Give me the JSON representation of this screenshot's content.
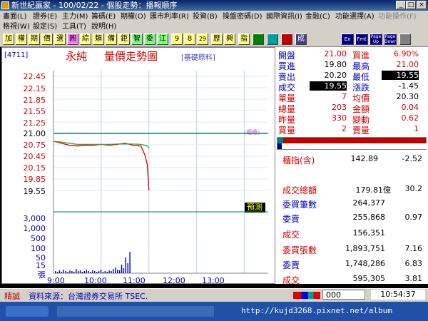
{
  "window": {
    "title": "新世紀贏家 - 100/02/22 - 個股走勢：播報順序"
  },
  "menu": {
    "row1": [
      "畫面(L)",
      "證券(E)",
      "主力(M)",
      "籌碼(E)",
      "期權(O)",
      "匯市利率(R)",
      "投資(B)",
      "操盤密碼(D)",
      "國際資訊(I)",
      "金融(C)",
      "功能選擇(A)",
      "功能操作(F)"
    ],
    "row2": [
      "格視(W)",
      "設定(S)",
      "工具(T)",
      "說明(H)"
    ]
  },
  "toolbar": {
    "buttons": [
      "加",
      "權",
      "期",
      "價",
      "選",
      "圓",
      "綜",
      "類",
      "備",
      "鉅",
      "智",
      "委",
      "江",
      "9",
      "8",
      "29",
      "歷",
      "興",
      "指",
      "",
      "",
      "",
      "成",
      "Ex",
      "Fmt",
      "Page Up",
      "Page Down",
      ""
    ]
  },
  "colors": {
    "accent": "#d00000",
    "blue": "#0000c0",
    "green": "#008000"
  },
  "chart": {
    "code": "[4711]",
    "name": "永純",
    "title": "量價走勢圖",
    "category": "[基礎原料]",
    "ref_label": "(櫃檯)",
    "session_label": "預測",
    "price_labels": [
      "22.45",
      "22.15",
      "21.85",
      "21.55",
      "21.25",
      "21.00",
      "20.75",
      "20.45",
      "20.15",
      "19.85",
      "19.55"
    ],
    "volume_labels": [
      "3,000",
      "1,000",
      "500",
      "100",
      "50",
      "15",
      "張"
    ],
    "time_labels": [
      "9:00",
      "10:00",
      "11:00",
      "12:00",
      "13:00"
    ]
  },
  "chart_data": {
    "type": "line",
    "title": "量價走勢圖",
    "xlabel": "",
    "ylabel": "",
    "x": [
      "9:00",
      "9:10",
      "9:20",
      "9:30",
      "9:40",
      "9:50",
      "10:00",
      "10:10",
      "10:20",
      "10:30",
      "10:40",
      "10:50",
      "10:55",
      "10:58",
      "11:00"
    ],
    "series": [
      {
        "values": [
          20.8,
          20.75,
          20.7,
          20.68,
          20.7,
          20.7,
          20.72,
          20.7,
          20.72,
          20.75,
          20.7,
          20.68,
          20.45,
          20.2,
          19.55
        ]
      },
      {
        "values": [
          20.8,
          20.78,
          20.75,
          20.72,
          20.72,
          20.72,
          20.72,
          20.72,
          20.73,
          20.73,
          20.73,
          20.72,
          20.7,
          20.68,
          20.63
        ]
      }
    ],
    "ylim": [
      19.55,
      22.45
    ],
    "reference": 21.0,
    "grid": true
  },
  "quote": {
    "rows": [
      {
        "l1": "開盤",
        "v1": "21.00",
        "l2": "振幅",
        "v2": "6.90%"
      },
      {
        "l1": "買進",
        "v1": "19.80",
        "l2": "最高",
        "v2": "21.00"
      },
      {
        "l1": "賣出",
        "v1": "20.20",
        "l2": "最低",
        "v2": "19.55"
      },
      {
        "l1": "成交",
        "v1": "19.55",
        "l2": "漲跌",
        "v2": "-1.45"
      },
      {
        "l1": "單量",
        "v1": "7",
        "l2": "均價",
        "v2": "20.30"
      },
      {
        "l1": "總量",
        "v1": "203",
        "l2": "金額",
        "v2": "0.04"
      },
      {
        "l1": "昨量",
        "v1": "330",
        "l2": "變動",
        "v2": "0.62"
      },
      {
        "l1": "買量",
        "v1": "2",
        "l2": "賣量",
        "v2": "1"
      }
    ]
  },
  "index": {
    "label": "櫃指(含)",
    "value": "142.89",
    "change": "-2.52"
  },
  "stats": [
    {
      "label": "成交總額",
      "value": "179.81億",
      "extra": "30.2"
    },
    {
      "label": "委買筆數",
      "value": "264,377",
      "extra": ""
    },
    {
      "label": "委賣",
      "value": "255,868",
      "extra": "0.97"
    },
    {
      "label": "成交",
      "value": "156,351",
      "extra": ""
    },
    {
      "label": "委買張數",
      "value": "1,893,751",
      "extra": "7.16"
    },
    {
      "label": "委賣",
      "value": "1,748,286",
      "extra": "6.83"
    },
    {
      "label": "成交",
      "value": "595,305",
      "extra": "3.81"
    }
  ],
  "status": {
    "tag": "精誠",
    "source": "資料來源：台灣證券交易所 TSEC.",
    "input_value": "000",
    "time": "10:54:37"
  },
  "taskbar": {
    "url": "http://kujd3268.pixnet.net/album"
  }
}
